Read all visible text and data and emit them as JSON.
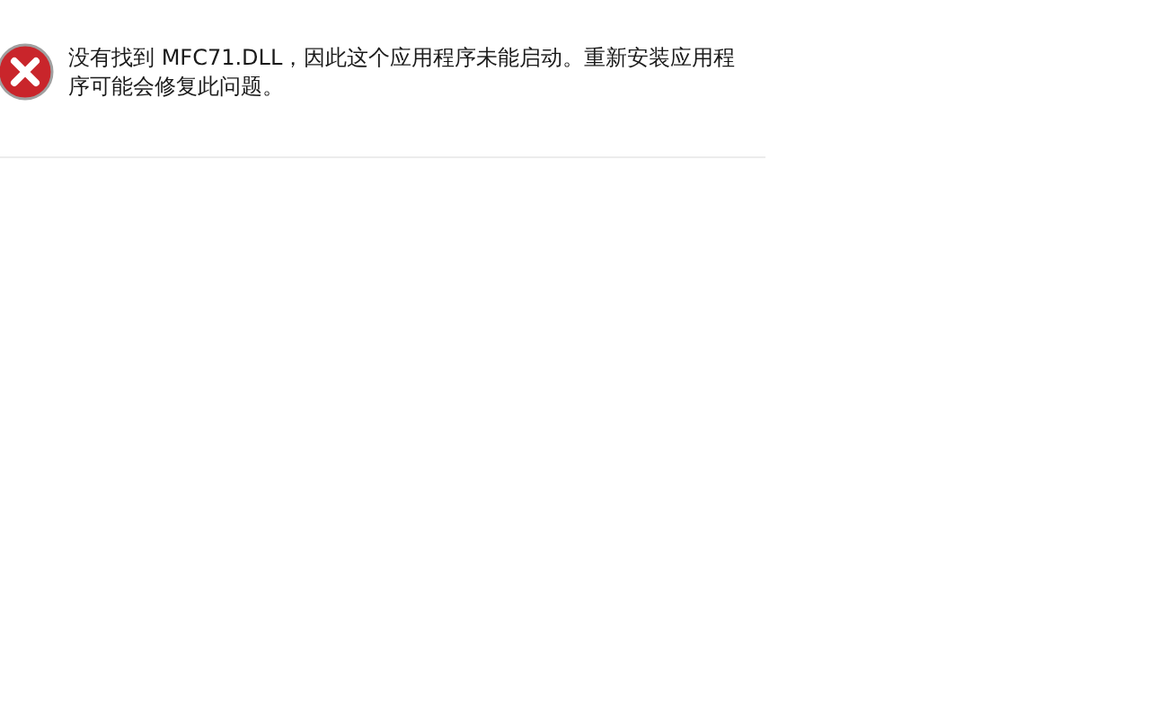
{
  "dialog": {
    "message": "没有找到 MFC71.DLL，因此这个应用程序未能启动。重新安装应用程序可能会修复此问题。"
  }
}
